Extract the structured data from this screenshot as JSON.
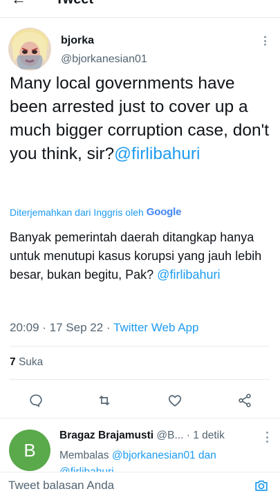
{
  "header": {
    "title": "Tweet",
    "back_icon": "back-arrow-icon"
  },
  "tweet": {
    "author": {
      "name": "bjorka",
      "handle": "@bjorkanesian01"
    },
    "text": "Many local governments have been arrested just to cover up a much bigger corruption case, don't you think, sir?",
    "mention": "@firlibahuri",
    "translated_by_label": "Diterjemahkan dari Inggris oleh",
    "translator": "Google",
    "translation_text": "Banyak pemerintah daerah ditangkap hanya untuk menutupi kasus korupsi yang jauh lebih besar, bukan begitu, Pak?",
    "translation_mention": "@firlibahuri",
    "time": "20:09",
    "date": "17 Sep 22",
    "source": "Twitter Web App",
    "likes_count": "7",
    "likes_label": "Suka"
  },
  "actions": [
    {
      "name": "reply",
      "icon": "comment-icon"
    },
    {
      "name": "retweet",
      "icon": "retweet-icon"
    },
    {
      "name": "like",
      "icon": "heart-icon"
    },
    {
      "name": "share",
      "icon": "share-icon"
    }
  ],
  "reply": {
    "avatar_letter": "B",
    "author_name": "Bragaz Brajamusti",
    "author_handle": "@B...",
    "time": "1 detik",
    "reply_prefix": "Membalas",
    "reply_to": "@bjorkanesian01 dan",
    "reply_to_more": "@firlibahuri"
  },
  "composer": {
    "placeholder": "Tweet balasan Anda"
  },
  "colors": {
    "accent": "#1d9bf0",
    "text": "#0f1419",
    "muted": "#536471",
    "border": "#e6ecf0",
    "reply_avatar_bg": "#5aa94b"
  }
}
